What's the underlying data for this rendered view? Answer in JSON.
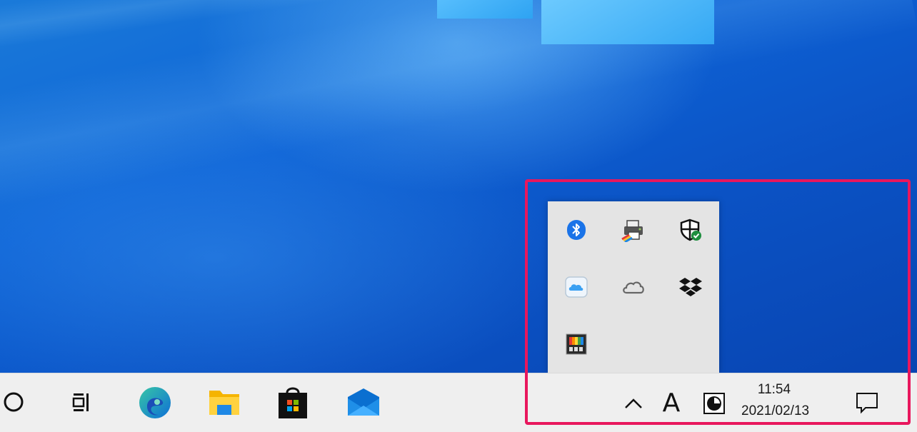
{
  "desktop": {
    "wallpaper": "windows-10-default-blue",
    "accent_color": "#0b52c4"
  },
  "tray_flyout": {
    "icons": [
      {
        "name": "bluetooth-icon",
        "color": "#1a73e8"
      },
      {
        "name": "printer-icon",
        "color": "#3a3a3a"
      },
      {
        "name": "windows-security-icon",
        "color": "#1e8e3e"
      },
      {
        "name": "icloud-icon",
        "color": "#3aa0f2"
      },
      {
        "name": "onedrive-icon",
        "color": "#666666"
      },
      {
        "name": "dropbox-icon",
        "color": "#111111"
      },
      {
        "name": "color-app-icon",
        "color": "#333333"
      }
    ]
  },
  "taskbar": {
    "apps": [
      {
        "name": "cortana-icon"
      },
      {
        "name": "task-view-icon"
      },
      {
        "name": "edge-icon"
      },
      {
        "name": "file-explorer-icon"
      },
      {
        "name": "microsoft-store-icon"
      },
      {
        "name": "mail-icon"
      }
    ],
    "tray": {
      "show_hidden_label": "^",
      "ime_label": "A",
      "clock_time": "11:54",
      "clock_date": "2021/02/13"
    },
    "highlight_color": "#e8175d"
  }
}
